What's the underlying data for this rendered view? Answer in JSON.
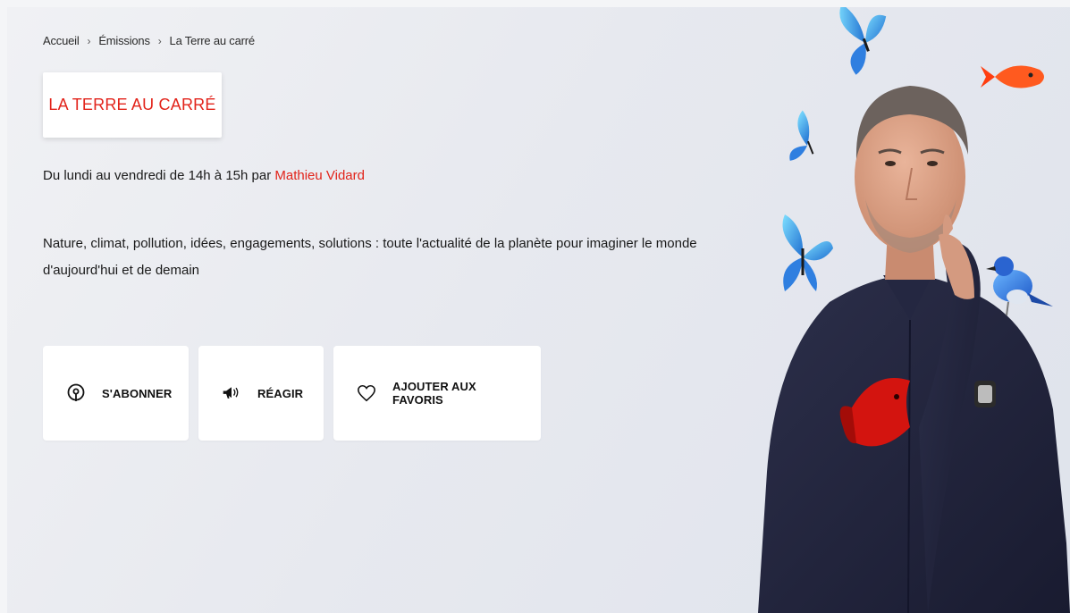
{
  "breadcrumb": {
    "items": [
      "Accueil",
      "Émissions",
      "La Terre au carré"
    ],
    "separator": "›"
  },
  "show": {
    "title": "LA TERRE AU CARRÉ",
    "schedule_prefix": "Du lundi au vendredi de 14h à 15h par ",
    "host": "Mathieu Vidard",
    "description": "Nature, climat, pollution, idées, engagements, solutions : toute l'actualité de la planète pour imaginer le monde d'aujourd'hui et de demain"
  },
  "actions": {
    "subscribe": {
      "label": "S'ABONNER",
      "icon": "podcast-icon"
    },
    "react": {
      "label": "RÉAGIR",
      "icon": "megaphone-icon"
    },
    "favorite": {
      "label": "AJOUTER AUX FAVORIS",
      "icon": "heart-icon"
    }
  },
  "colors": {
    "accent": "#e2231a",
    "text": "#1a1a1a",
    "background": "#e7e9ef"
  }
}
